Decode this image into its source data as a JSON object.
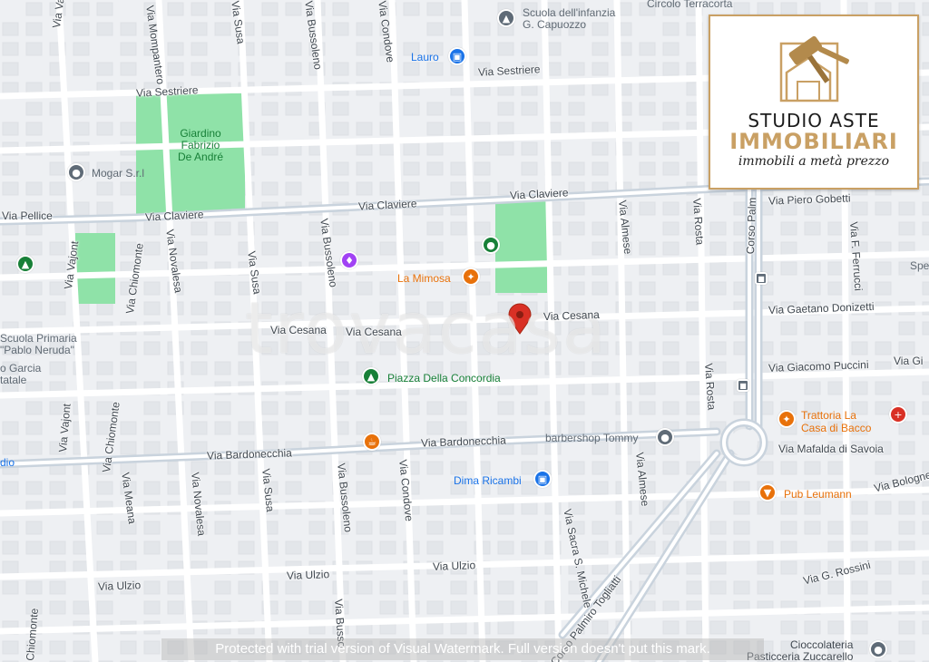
{
  "map": {
    "streets": [
      {
        "id": "via-vajont-n",
        "text": "Via Vajont"
      },
      {
        "id": "via-mompantero",
        "text": "Via Mompantero"
      },
      {
        "id": "via-susa-n",
        "text": "Via Susa"
      },
      {
        "id": "via-bussoleno-n",
        "text": "Via Bussoleno"
      },
      {
        "id": "via-condove-n",
        "text": "Via Condove"
      },
      {
        "id": "via-sestriere-w",
        "text": "Via Sestriere"
      },
      {
        "id": "via-sestriere-e",
        "text": "Via Sestriere"
      },
      {
        "id": "via-pellice",
        "text": "Via Pellice"
      },
      {
        "id": "via-claviere-w",
        "text": "Via Claviere"
      },
      {
        "id": "via-claviere-m",
        "text": "Via Claviere"
      },
      {
        "id": "via-claviere-e",
        "text": "Via Claviere"
      },
      {
        "id": "via-piero-gobetti",
        "text": "Via Piero Gobetti"
      },
      {
        "id": "via-vajont-w",
        "text": "Via Vajont"
      },
      {
        "id": "via-chiomonte-n",
        "text": "Via Chiomonte"
      },
      {
        "id": "via-novalesa-n",
        "text": "Via Novalesa"
      },
      {
        "id": "via-susa-m",
        "text": "Via Susa"
      },
      {
        "id": "via-bussoleno-m",
        "text": "Via Bussoleno"
      },
      {
        "id": "via-almese-n",
        "text": "Via Almese"
      },
      {
        "id": "via-rosta-n",
        "text": "Via Rosta"
      },
      {
        "id": "corso-palmiro",
        "text": "Corso Palm"
      },
      {
        "id": "via-f-ferrucci",
        "text": "Via F. Ferrucci"
      },
      {
        "id": "via-cesana-w",
        "text": "Via Cesana"
      },
      {
        "id": "via-cesana-m",
        "text": "Via Cesana"
      },
      {
        "id": "via-cesana-e",
        "text": "Via Cesana"
      },
      {
        "id": "via-gaetano-donizetti",
        "text": "Via Gaetano Donizetti"
      },
      {
        "id": "via-giacomo-puccini",
        "text": "Via Giacomo Puccini"
      },
      {
        "id": "via-gi",
        "text": "Via Gi"
      },
      {
        "id": "via-rosta-s",
        "text": "Via Rosta"
      },
      {
        "id": "via-vajont-s",
        "text": "Via Vajont"
      },
      {
        "id": "via-chiomonte-s",
        "text": "Via Chiomonte"
      },
      {
        "id": "via-bardonecchia-w",
        "text": "Via Bardonecchia"
      },
      {
        "id": "via-bardonecchia-e",
        "text": "Via Bardonecchia"
      },
      {
        "id": "via-mafalda-di-savoia",
        "text": "Via Mafalda di Savoia"
      },
      {
        "id": "via-bolognese",
        "text": "Via Bolognese"
      },
      {
        "id": "via-meana",
        "text": "Via Meana"
      },
      {
        "id": "via-novalesa-s",
        "text": "Via Novalesa"
      },
      {
        "id": "via-susa-s",
        "text": "Via Susa"
      },
      {
        "id": "via-bussoleno-s",
        "text": "Via Bussoleno"
      },
      {
        "id": "via-condove-s",
        "text": "Via Condove"
      },
      {
        "id": "via-almese-s",
        "text": "Via Almese"
      },
      {
        "id": "via-sacra-s-michele",
        "text": "Via Sacra S. Michele"
      },
      {
        "id": "corso-palmiro-togliatti",
        "text": "Corso Palmiro Togliatti"
      },
      {
        "id": "via-ulzio-w",
        "text": "Via Ulzio"
      },
      {
        "id": "via-ulzio-m",
        "text": "Via Ulzio"
      },
      {
        "id": "via-ulzio-e",
        "text": "Via Ulzio"
      },
      {
        "id": "via-g-rossini",
        "text": "Via G. Rossini"
      },
      {
        "id": "via-chiomonte-sw",
        "text": "Chiomonte"
      },
      {
        "id": "via-bussoleno-s2",
        "text": "Via Busso"
      }
    ],
    "parks": [
      {
        "id": "giardino-fabrizio-de-andre",
        "text": "Giardino\nFabrizio\nDe André"
      }
    ],
    "pois": [
      {
        "id": "circolo-terracorta",
        "text": "Circolo Terracorta",
        "icon": "none",
        "color": "#606a74"
      },
      {
        "id": "scuola-dell-infanzia",
        "text": "Scuola dell'infanzia\nG. Capuozzo",
        "icon": "school",
        "color": "#606a74"
      },
      {
        "id": "lauro",
        "text": "Lauro",
        "icon": "shopping-bag",
        "color": "#1a73e8"
      },
      {
        "id": "mogar",
        "text": "Mogar S.r.l",
        "icon": "place",
        "color": "#606a74"
      },
      {
        "id": "scuola-primaria",
        "text": "Scuola Primaria\n\"Pablo Neruda\"",
        "icon": "none",
        "color": "#606a74"
      },
      {
        "id": "garcia-statale",
        "text": "o Garcia\ntatale",
        "icon": "none",
        "color": "#606a74"
      },
      {
        "id": "la-mimosa",
        "text": "La Mimosa",
        "icon": "restaurant",
        "color": "#e8710a"
      },
      {
        "id": "piazza-della-concordia",
        "text": "Piazza Della Concordia",
        "icon": "tree",
        "color": "#188038"
      },
      {
        "id": "barbershop-tommy",
        "text": "barbershop Tommy",
        "icon": "place",
        "color": "#606a74"
      },
      {
        "id": "dima-ricambi",
        "text": "Dima Ricambi",
        "icon": "shopping-bag",
        "color": "#1a73e8"
      },
      {
        "id": "trattoria-la-casa-di-bacco",
        "text": "Trattoria La\nCasa di Bacco",
        "icon": "restaurant",
        "color": "#e8710a"
      },
      {
        "id": "pub-leumann",
        "text": "Pub Leumann",
        "icon": "bar",
        "color": "#e8710a"
      },
      {
        "id": "cioccolateria",
        "text": "Cioccolateria\nPasticceria Zuccarello",
        "icon": "place",
        "color": "#606a74"
      },
      {
        "id": "spe",
        "text": "Spe",
        "icon": "none",
        "color": "#606a74"
      },
      {
        "id": "studio",
        "text": "dio",
        "icon": "none",
        "color": "#1a73e8"
      }
    ]
  },
  "logo": {
    "line1": "STUDIO ASTE",
    "line2": "IMMOBILIARI",
    "line3": "immobili a metà prezzo"
  },
  "watermark": "trovacasa",
  "footer_watermark": "Protected with trial version of Visual Watermark. Full version doesn't put this mark.",
  "colors": {
    "map_bg": "#eef0f3",
    "road": "#ffffff",
    "main_road": "#c7d1dc",
    "park": "#8fe2a8",
    "pin": "#d93025",
    "logo_gold": "#c9a064"
  }
}
